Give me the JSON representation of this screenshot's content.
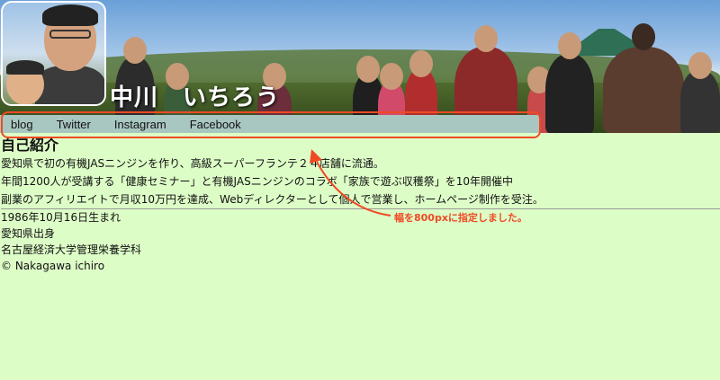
{
  "header": {
    "site_title": "中川　いちろう"
  },
  "nav": {
    "items": [
      {
        "label": "blog"
      },
      {
        "label": "Twitter"
      },
      {
        "label": "Instagram"
      },
      {
        "label": "Facebook"
      }
    ]
  },
  "intro": {
    "title": "自己紹介",
    "lines": [
      "愛知県で初の有機JASニンジンを作り、高級スーパーフランテ２４店舗に流通。",
      "年間1200人が受講する「健康セミナー」と有機JASニンジンのコラボ「家族で遊ぶ収穫祭」を10年開催中",
      "副業のアフィリエイトで月収10万円を達成、Webディレクターとして個人で営業し、ホームページ制作を受注。"
    ]
  },
  "facts": {
    "lines": [
      "1986年10月16日生まれ",
      "愛知県出身",
      "名古屋経済大学管理栄養学科"
    ]
  },
  "footer": {
    "copyright": "© Nakagawa ichiro"
  },
  "annotation": {
    "text": "幅を800pxに指定しました。",
    "color": "#ef4a24"
  },
  "colors": {
    "page_background": "#ddfdc7",
    "nav_background": "#a9c7c1"
  }
}
